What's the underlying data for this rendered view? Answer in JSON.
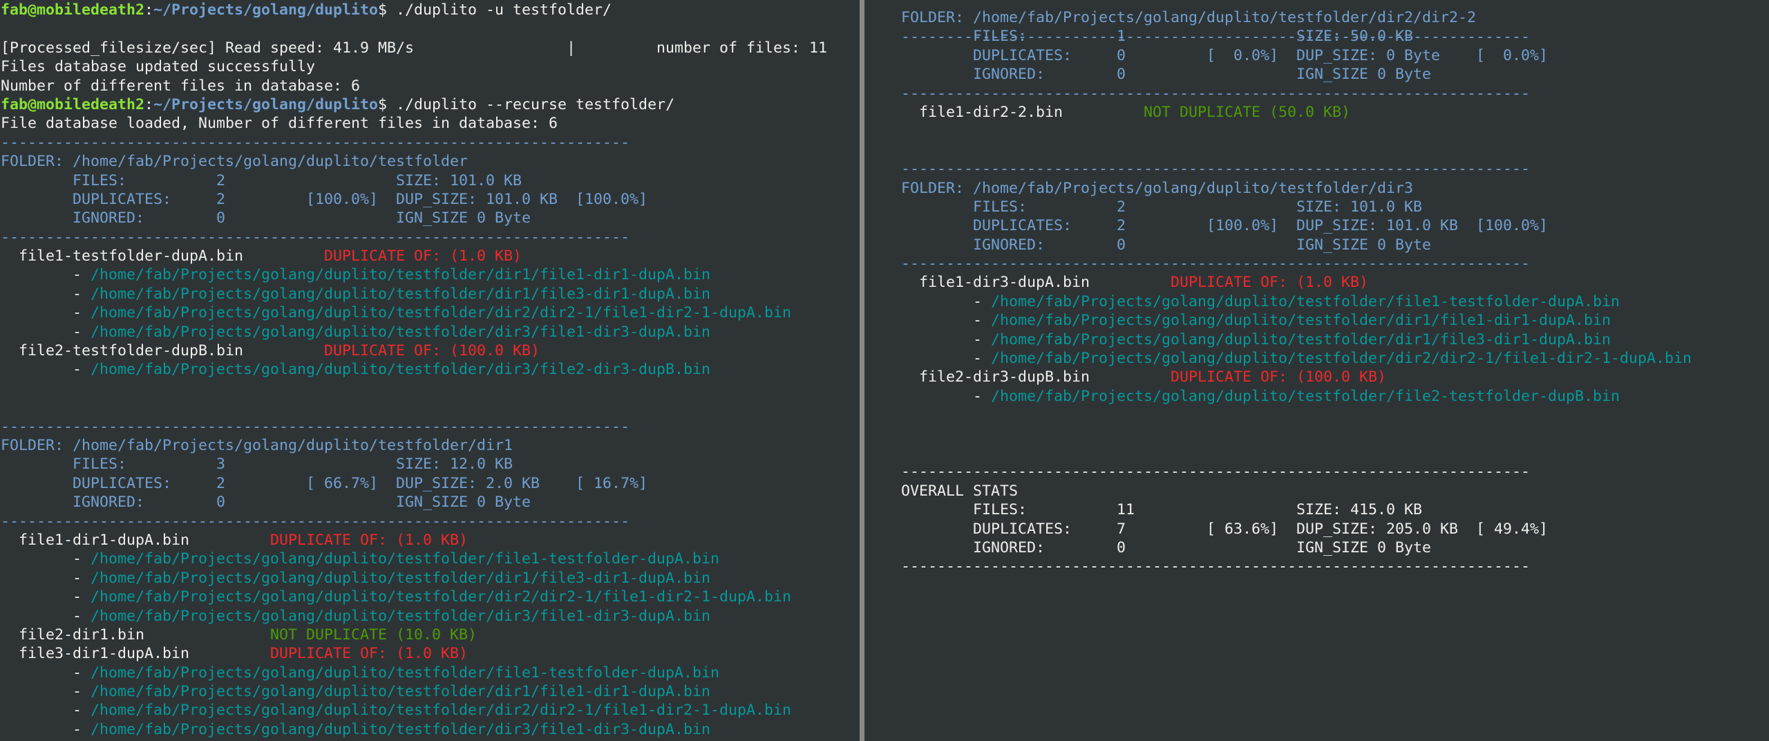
{
  "left_pane": [
    [
      [
        "user",
        "fab@mobiledeath2"
      ],
      [
        "white",
        ":"
      ],
      [
        "path",
        "~/Projects/golang/duplito"
      ],
      [
        "white",
        "$ ./duplito -u testfolder/"
      ]
    ],
    [
      [
        "white",
        ""
      ]
    ],
    [
      [
        "white",
        "[Processed_filesize/sec] Read speed: 41.9 MB/s                 |         number of files: 11"
      ]
    ],
    [
      [
        "white",
        "Files database updated successfully"
      ]
    ],
    [
      [
        "white",
        "Number of different files in database: 6"
      ]
    ],
    [
      [
        "user",
        "fab@mobiledeath2"
      ],
      [
        "white",
        ":"
      ],
      [
        "path",
        "~/Projects/golang/duplito"
      ],
      [
        "white",
        "$ ./duplito --recurse testfolder/"
      ]
    ],
    [
      [
        "white",
        "File database loaded, Number of different files in database: 6"
      ]
    ],
    [
      [
        "blue",
        "----------------------------------------------------------------------"
      ]
    ],
    [
      [
        "blue",
        "FOLDER: /home/fab/Projects/golang/duplito/testfolder"
      ]
    ],
    [
      [
        "blue",
        "        FILES:          2                   SIZE: 101.0 KB"
      ]
    ],
    [
      [
        "blue",
        "        DUPLICATES:     2         [100.0%]  DUP_SIZE: 101.0 KB  [100.0%]"
      ]
    ],
    [
      [
        "blue",
        "        IGNORED:        0                   IGN_SIZE 0 Byte"
      ]
    ],
    [
      [
        "blue",
        "----------------------------------------------------------------------"
      ]
    ],
    [
      [
        "white",
        "  file1-testfolder-dupA.bin         "
      ],
      [
        "red",
        "DUPLICATE OF: (1.0 KB)"
      ]
    ],
    [
      [
        "white",
        "        - "
      ],
      [
        "teal",
        "/home/fab/Projects/golang/duplito/testfolder/dir1/file1-dir1-dupA.bin"
      ]
    ],
    [
      [
        "white",
        "        - "
      ],
      [
        "teal",
        "/home/fab/Projects/golang/duplito/testfolder/dir1/file3-dir1-dupA.bin"
      ]
    ],
    [
      [
        "white",
        "        - "
      ],
      [
        "teal",
        "/home/fab/Projects/golang/duplito/testfolder/dir2/dir2-1/file1-dir2-1-dupA.bin"
      ]
    ],
    [
      [
        "white",
        "        - "
      ],
      [
        "teal",
        "/home/fab/Projects/golang/duplito/testfolder/dir3/file1-dir3-dupA.bin"
      ]
    ],
    [
      [
        "white",
        "  file2-testfolder-dupB.bin         "
      ],
      [
        "red",
        "DUPLICATE OF: (100.0 KB)"
      ]
    ],
    [
      [
        "white",
        "        - "
      ],
      [
        "teal",
        "/home/fab/Projects/golang/duplito/testfolder/dir3/file2-dir3-dupB.bin"
      ]
    ],
    [
      [
        "white",
        ""
      ]
    ],
    [
      [
        "white",
        ""
      ]
    ],
    [
      [
        "blue",
        "----------------------------------------------------------------------"
      ]
    ],
    [
      [
        "blue",
        "FOLDER: /home/fab/Projects/golang/duplito/testfolder/dir1"
      ]
    ],
    [
      [
        "blue",
        "        FILES:          3                   SIZE: 12.0 KB"
      ]
    ],
    [
      [
        "blue",
        "        DUPLICATES:     2         [ 66.7%]  DUP_SIZE: 2.0 KB    [ 16.7%]"
      ]
    ],
    [
      [
        "blue",
        "        IGNORED:        0                   IGN_SIZE 0 Byte"
      ]
    ],
    [
      [
        "blue",
        "----------------------------------------------------------------------"
      ]
    ],
    [
      [
        "white",
        "  file1-dir1-dupA.bin         "
      ],
      [
        "red",
        "DUPLICATE OF: (1.0 KB)"
      ]
    ],
    [
      [
        "white",
        "        - "
      ],
      [
        "teal",
        "/home/fab/Projects/golang/duplito/testfolder/file1-testfolder-dupA.bin"
      ]
    ],
    [
      [
        "white",
        "        - "
      ],
      [
        "teal",
        "/home/fab/Projects/golang/duplito/testfolder/dir1/file3-dir1-dupA.bin"
      ]
    ],
    [
      [
        "white",
        "        - "
      ],
      [
        "teal",
        "/home/fab/Projects/golang/duplito/testfolder/dir2/dir2-1/file1-dir2-1-dupA.bin"
      ]
    ],
    [
      [
        "white",
        "        - "
      ],
      [
        "teal",
        "/home/fab/Projects/golang/duplito/testfolder/dir3/file1-dir3-dupA.bin"
      ]
    ],
    [
      [
        "white",
        "  file2-dir1.bin              "
      ],
      [
        "green",
        "NOT DUPLICATE (10.0 KB)"
      ]
    ],
    [
      [
        "white",
        "  file3-dir1-dupA.bin         "
      ],
      [
        "red",
        "DUPLICATE OF: (1.0 KB)"
      ]
    ],
    [
      [
        "white",
        "        - "
      ],
      [
        "teal",
        "/home/fab/Projects/golang/duplito/testfolder/file1-testfolder-dupA.bin"
      ]
    ],
    [
      [
        "white",
        "        - "
      ],
      [
        "teal",
        "/home/fab/Projects/golang/duplito/testfolder/dir1/file1-dir1-dupA.bin"
      ]
    ],
    [
      [
        "white",
        "        - "
      ],
      [
        "teal",
        "/home/fab/Projects/golang/duplito/testfolder/dir2/dir2-1/file1-dir2-1-dupA.bin"
      ]
    ],
    [
      [
        "white",
        "        - "
      ],
      [
        "teal",
        "/home/fab/Projects/golang/duplito/testfolder/dir3/file1-dir3-dupA.bin"
      ]
    ]
  ],
  "right_pane": [
    [
      [
        "blue",
        "FOLDER: /home/fab/Projects/golang/duplito/testfolder/dir2/dir2-2"
      ]
    ],
    [
      [
        "blue",
        "        FILES:          1                   SIZE: 50.0 KB"
      ]
    ],
    [
      [
        "blue",
        "        DUPLICATES:     0         [  0.0%]  DUP_SIZE: 0 Byte    [  0.0%]"
      ]
    ],
    [
      [
        "blue",
        "        IGNORED:        0                   IGN_SIZE 0 Byte"
      ]
    ],
    [
      [
        "blue",
        "----------------------------------------------------------------------"
      ]
    ],
    [
      [
        "white",
        "  file1-dir2-2.bin         "
      ],
      [
        "green",
        "NOT DUPLICATE (50.0 KB)"
      ]
    ],
    [
      [
        "white",
        ""
      ]
    ],
    [
      [
        "white",
        ""
      ]
    ],
    [
      [
        "blue",
        "----------------------------------------------------------------------"
      ]
    ],
    [
      [
        "blue",
        "FOLDER: /home/fab/Projects/golang/duplito/testfolder/dir3"
      ]
    ],
    [
      [
        "blue",
        "        FILES:          2                   SIZE: 101.0 KB"
      ]
    ],
    [
      [
        "blue",
        "        DUPLICATES:     2         [100.0%]  DUP_SIZE: 101.0 KB  [100.0%]"
      ]
    ],
    [
      [
        "blue",
        "        IGNORED:        0                   IGN_SIZE 0 Byte"
      ]
    ],
    [
      [
        "blue",
        "----------------------------------------------------------------------"
      ]
    ],
    [
      [
        "white",
        "  file1-dir3-dupA.bin         "
      ],
      [
        "red",
        "DUPLICATE OF: (1.0 KB)"
      ]
    ],
    [
      [
        "white",
        "        - "
      ],
      [
        "teal",
        "/home/fab/Projects/golang/duplito/testfolder/file1-testfolder-dupA.bin"
      ]
    ],
    [
      [
        "white",
        "        - "
      ],
      [
        "teal",
        "/home/fab/Projects/golang/duplito/testfolder/dir1/file1-dir1-dupA.bin"
      ]
    ],
    [
      [
        "white",
        "        - "
      ],
      [
        "teal",
        "/home/fab/Projects/golang/duplito/testfolder/dir1/file3-dir1-dupA.bin"
      ]
    ],
    [
      [
        "white",
        "        - "
      ],
      [
        "teal",
        "/home/fab/Projects/golang/duplito/testfolder/dir2/dir2-1/file1-dir2-1-dupA.bin"
      ]
    ],
    [
      [
        "white",
        "  file2-dir3-dupB.bin         "
      ],
      [
        "red",
        "DUPLICATE OF: (100.0 KB)"
      ]
    ],
    [
      [
        "white",
        "        - "
      ],
      [
        "teal",
        "/home/fab/Projects/golang/duplito/testfolder/file2-testfolder-dupB.bin"
      ]
    ],
    [
      [
        "white",
        ""
      ]
    ],
    [
      [
        "white",
        ""
      ]
    ],
    [
      [
        "white",
        ""
      ]
    ],
    [
      [
        "white",
        "----------------------------------------------------------------------"
      ]
    ],
    [
      [
        "white",
        "OVERALL STATS"
      ]
    ],
    [
      [
        "white",
        "        FILES:          11                  SIZE: 415.0 KB"
      ]
    ],
    [
      [
        "white",
        "        DUPLICATES:     7         [ 63.6%]  DUP_SIZE: 205.0 KB  [ 49.4%]"
      ]
    ],
    [
      [
        "white",
        "        IGNORED:        0                   IGN_SIZE 0 Byte"
      ]
    ],
    [
      [
        "white",
        "----------------------------------------------------------------------"
      ]
    ]
  ],
  "right_top_partial": "----------------------------------------------------------------------"
}
